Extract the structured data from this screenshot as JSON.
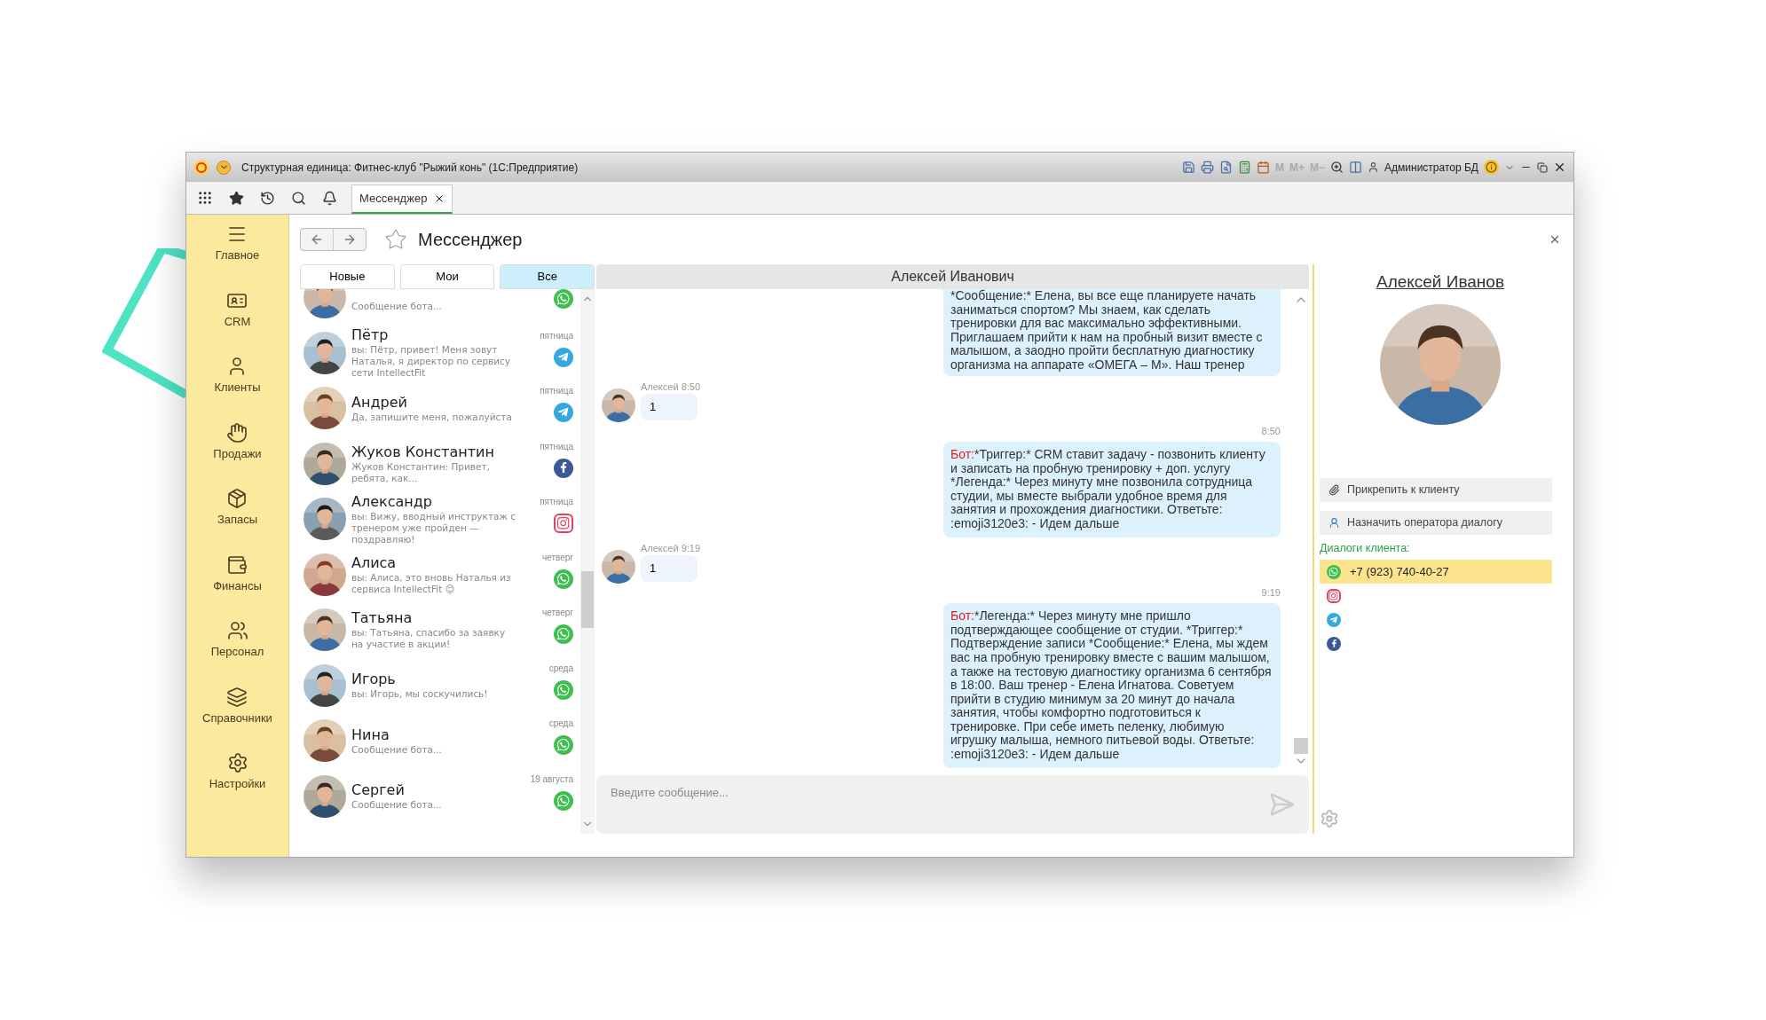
{
  "window": {
    "title": "Структурная единица: Фитнес-клуб \"Рыжий конь\"  (1С:Предприятие)",
    "memory_buttons": [
      "M",
      "M+",
      "M−"
    ],
    "user": "Администратор БД"
  },
  "open_tabs": [
    {
      "label": "Мессенджер",
      "selected": true
    }
  ],
  "sidebar": {
    "items": [
      {
        "label": "Главное",
        "kind": "menu"
      },
      {
        "label": "CRM",
        "kind": "crm"
      },
      {
        "label": "Клиенты",
        "kind": "clients"
      },
      {
        "label": "Продажи",
        "kind": "sales"
      },
      {
        "label": "Запасы",
        "kind": "stock"
      },
      {
        "label": "Финансы",
        "kind": "finance"
      },
      {
        "label": "Персонал",
        "kind": "staff"
      },
      {
        "label": "Справочники",
        "kind": "refs"
      },
      {
        "label": "Настройки",
        "kind": "settings"
      }
    ]
  },
  "page": {
    "title": "Мессенджер"
  },
  "filter_tabs": [
    {
      "label": "Новые",
      "selected": false
    },
    {
      "label": "Мои",
      "selected": false
    },
    {
      "label": "Все",
      "selected": true
    }
  ],
  "contacts": [
    {
      "preview": "Сообщение бота...",
      "kind": "whatsapp"
    },
    {
      "name": "Пётр",
      "preview": "вы: Пётр, привет! Меня зовут Наталья, я директор по сервису сети IntellectFit",
      "day": "пятница",
      "kind": "telegram"
    },
    {
      "name": "Андрей",
      "preview": "Да, запишите меня, пожалуйста",
      "day": "пятница",
      "kind": "telegram"
    },
    {
      "name": "Жуков  Константин",
      "preview": "Жуков Константин: Привет, ребята, как...",
      "day": "пятница",
      "kind": "facebook"
    },
    {
      "name": "Александр",
      "preview": "вы: Вижу, вводный инструктаж с тренером уже пройден — поздравляю!",
      "day": "пятница",
      "kind": "instagram"
    },
    {
      "name": "Алиса",
      "preview": "вы: Алиса, это вновь Наталья из сервиса IntellectFit 😊",
      "day": "четверг",
      "kind": "whatsapp"
    },
    {
      "name": "Татьяна",
      "preview": "вы: Татьяна, спасибо за заявку на участие в акции!",
      "day": "четверг",
      "kind": "whatsapp"
    },
    {
      "name": "Игорь",
      "preview": "вы: Игорь, мы соскучились!",
      "day": "среда",
      "kind": "whatsapp"
    },
    {
      "name": "Нина",
      "preview": "Сообщение бота...",
      "day": "среда",
      "kind": "whatsapp"
    },
    {
      "name": "Сергей",
      "preview": "Сообщение бота...",
      "day": "19 августа",
      "kind": "whatsapp"
    }
  ],
  "chat": {
    "title": "Алексей Иванович",
    "messages": [
      {
        "kind": "outgoing",
        "text": "*Сообщение:* Елена, вы все еще планируете начать заниматься спортом? Мы знаем, как сделать тренировки для вас максимально эффективными. Приглашаем прийти к нам на пробный визит вместе с малышом, а заодно пройти бесплатную диагностику организма на аппарате «ОМЕГА – М». Наш тренер"
      },
      {
        "kind": "incoming",
        "meta": "Алексей 8:50",
        "text": "1"
      },
      {
        "kind": "outgoing",
        "time": "8:50",
        "prefix": "Бот:",
        "text": "*Триггер:* CRM ставит задачу - позвонить клиенту и записать на пробную тренировку + доп. услугу *Легенда:* Через минуту мне позвонила сотрудница студии, мы вместе выбрали удобное время для занятия и прохождения диагностики. Ответьте: :emoji3120e3: - Идем дальше"
      },
      {
        "kind": "incoming",
        "meta": "Алексей 9:19",
        "text": "1"
      },
      {
        "kind": "outgoing",
        "time": "9:19",
        "prefix": "Бот:",
        "text": "*Легенда:* Через минуту мне пришло подтверждающее сообщение от студии. *Триггер:* Подтверждение записи *Сообщение:* Елена, мы ждем вас на пробную тренировку вместе с вашим малышом, а также на тестовую диагностику организма 6 сентября в 18:00. Ваш тренер - Елена Игнатова. Советуем прийти в студию минимум за 20 минут до начала занятия, чтобы комфортно подготовиться к тренировке. При себе иметь пеленку, любимую игрушку малыша, немного питьевой воды. Ответьте: :emoji3120e3: - Идем дальше"
      }
    ],
    "input": {
      "placeholder": "Введите сообщение..."
    }
  },
  "client": {
    "name": "Алексей Иванов",
    "actions": [
      {
        "label": "Прикрепить к клиенту",
        "kind": "attach"
      },
      {
        "label": "Назначить оператора диалогу",
        "kind": "operator"
      }
    ],
    "dialogs_label": "Диалоги клиента:",
    "dialogs": [
      {
        "kind": "whatsapp",
        "label": "+7 (923) 740-40-27",
        "selected": true
      },
      {
        "kind": "instagram",
        "selected": false
      },
      {
        "kind": "telegram",
        "selected": false
      },
      {
        "kind": "facebook",
        "selected": false
      }
    ]
  }
}
